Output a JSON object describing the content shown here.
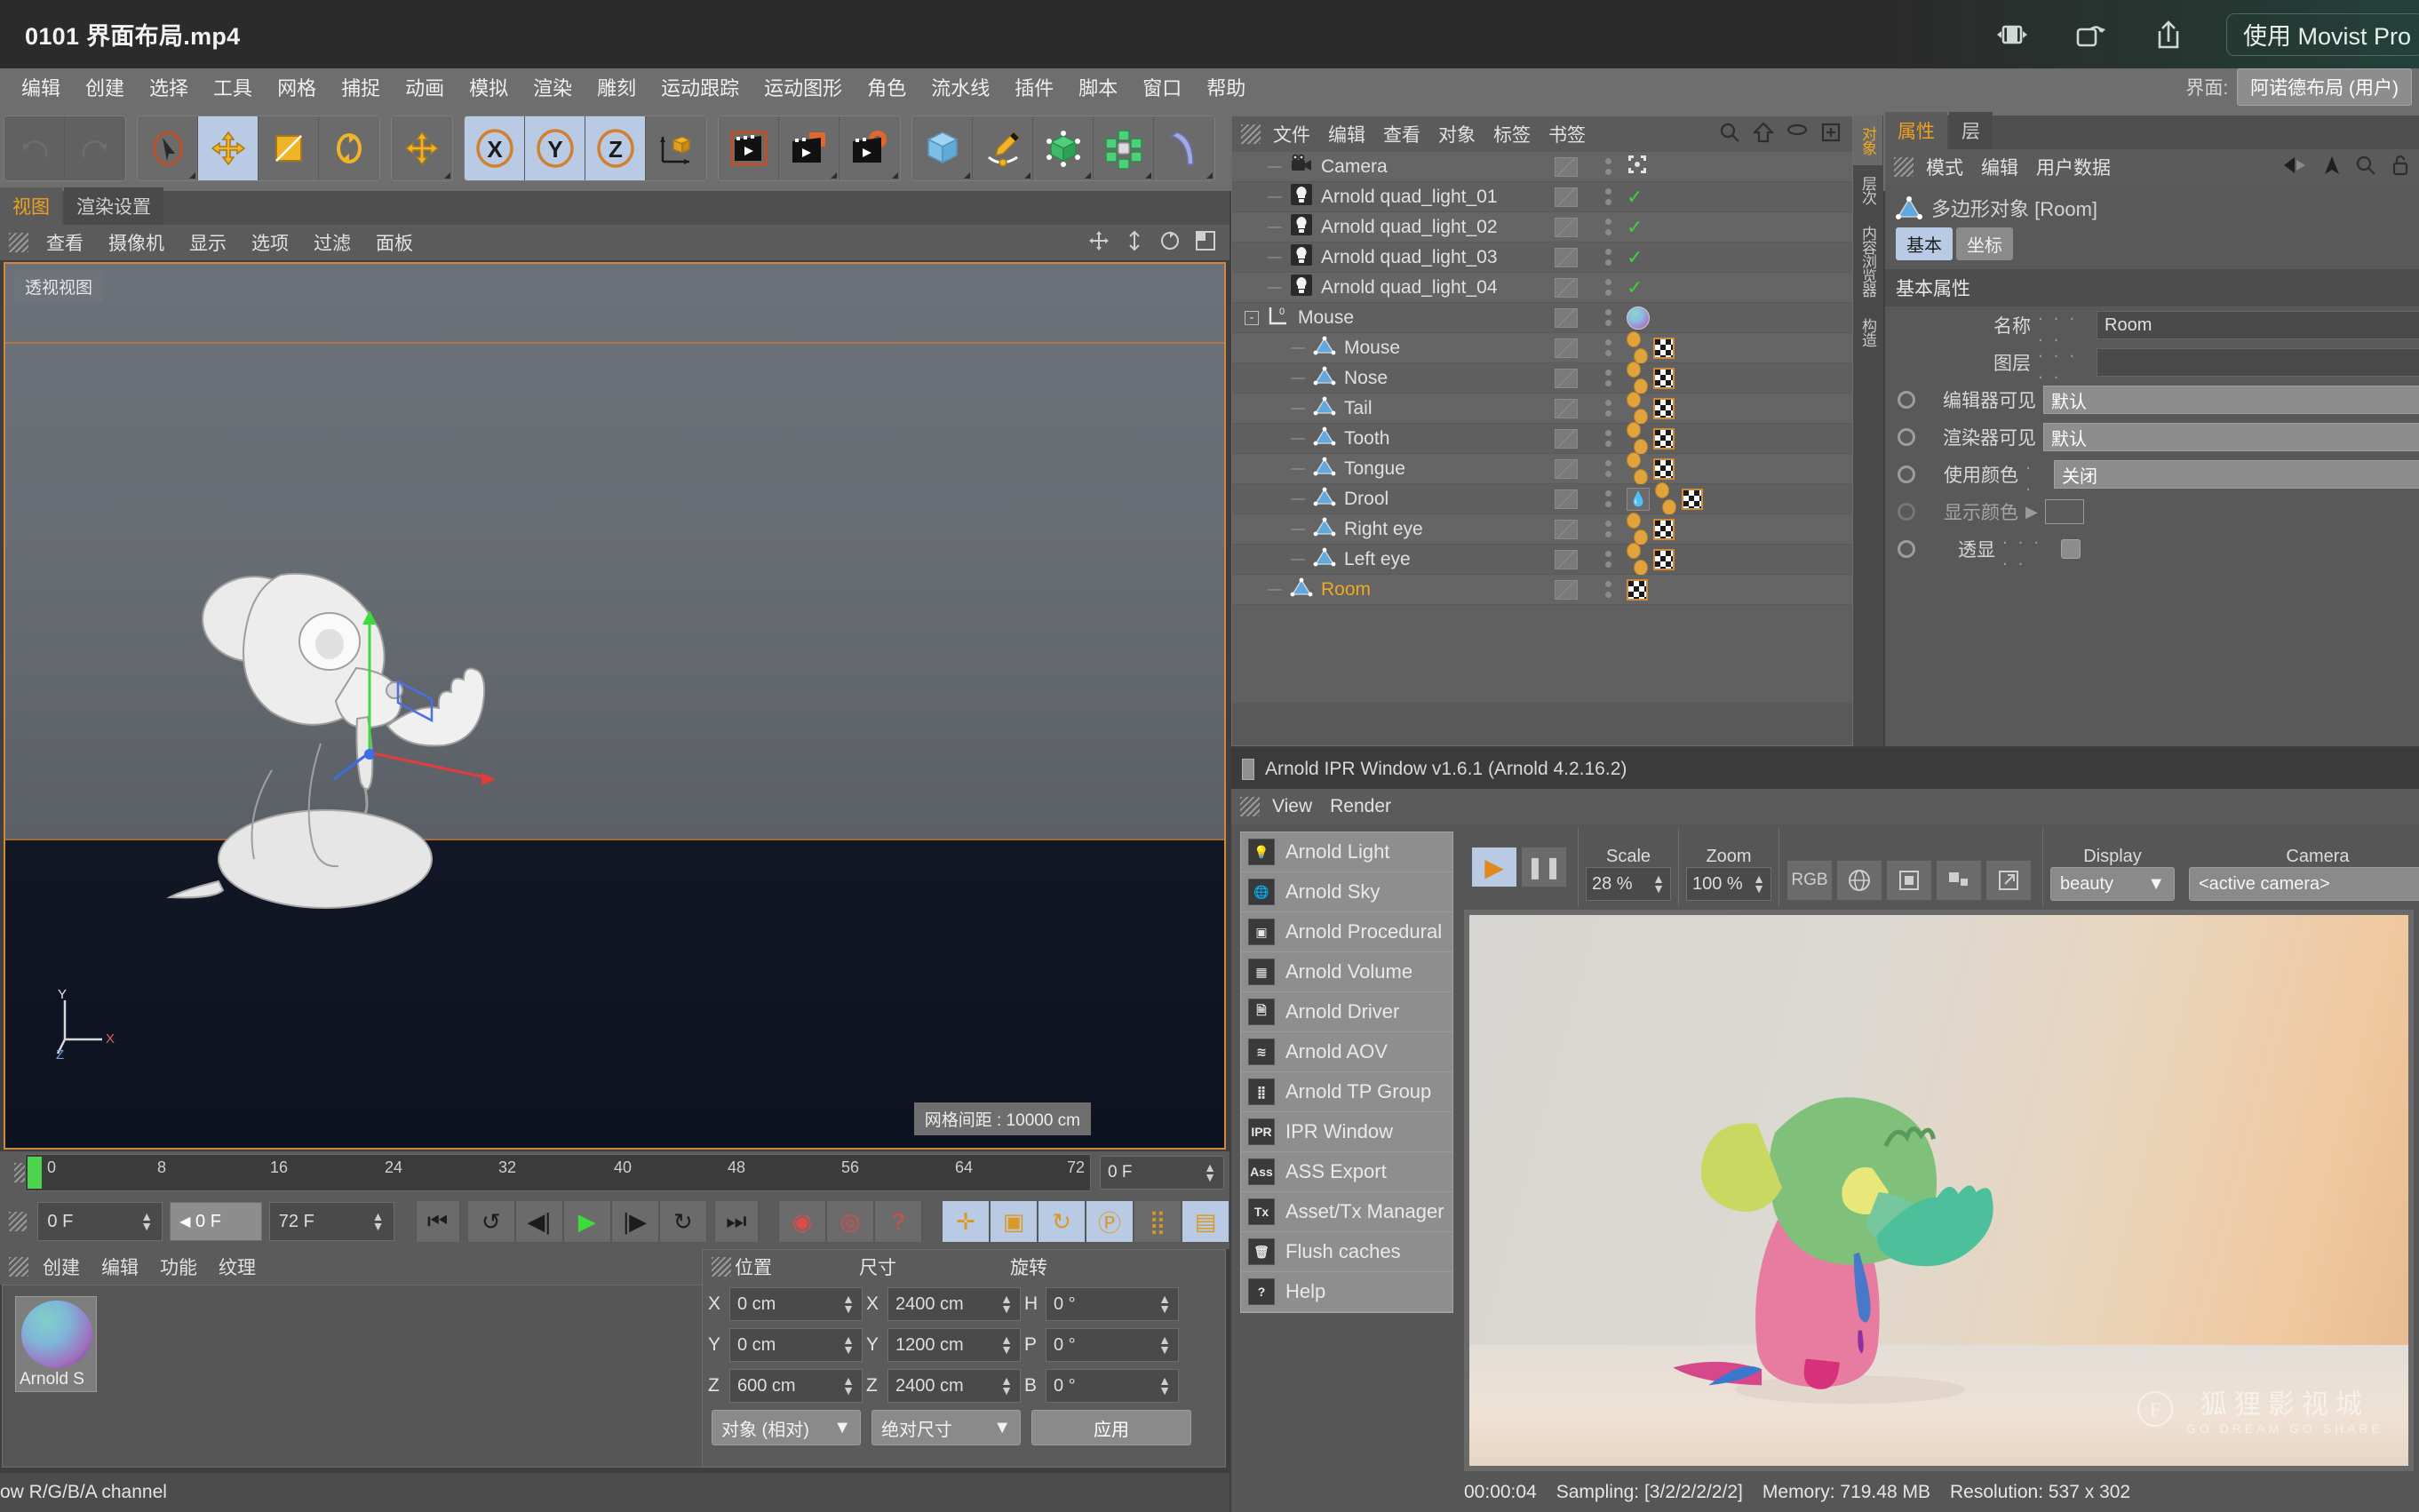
{
  "media": {
    "title": "0101 界面布局.mp4",
    "buttons": [
      "fullscreen-toggle-icon",
      "rotate-icon",
      "share-icon"
    ],
    "promo": "使用 Movist Pro"
  },
  "menubar": {
    "items": [
      "编辑",
      "创建",
      "选择",
      "工具",
      "网格",
      "捕捉",
      "动画",
      "模拟",
      "渲染",
      "雕刻",
      "运动跟踪",
      "运动图形",
      "角色",
      "流水线",
      "插件",
      "脚本",
      "窗口",
      "帮助"
    ],
    "layout_label": "界面:",
    "layout_value": "阿诺德布局 (用户)"
  },
  "toolbar": {
    "groups": [
      {
        "name": "undo-redo",
        "buttons": [
          {
            "icon": "undo-icon"
          },
          {
            "icon": "redo-icon"
          }
        ]
      },
      {
        "name": "transform",
        "buttons": [
          {
            "icon": "select-arrow-icon",
            "active": false
          },
          {
            "icon": "move-icon",
            "active": true
          },
          {
            "icon": "scale-icon",
            "active": false
          },
          {
            "icon": "rotate-icon",
            "active": false
          }
        ]
      },
      {
        "name": "move-group",
        "buttons": [
          {
            "icon": "move-alt-icon",
            "active": false
          }
        ]
      },
      {
        "name": "axis-lock",
        "buttons": [
          {
            "icon": "axis-x-icon",
            "active": true,
            "label": "X"
          },
          {
            "icon": "axis-y-icon",
            "active": true,
            "label": "Y"
          },
          {
            "icon": "axis-z-icon",
            "active": true,
            "label": "Z"
          },
          {
            "icon": "world-coord-icon",
            "active": false
          }
        ]
      },
      {
        "name": "render",
        "buttons": [
          {
            "icon": "render-view-icon",
            "active": false
          },
          {
            "icon": "render-picture-viewer-icon",
            "active": false
          },
          {
            "icon": "render-settings-icon",
            "active": false
          }
        ]
      },
      {
        "name": "primitives",
        "buttons": [
          {
            "icon": "cube-icon"
          },
          {
            "icon": "spline-pen-icon"
          },
          {
            "icon": "nurbs-icon"
          },
          {
            "icon": "array-icon"
          },
          {
            "icon": "deformer-icon"
          }
        ]
      }
    ]
  },
  "viewport": {
    "tabs": [
      {
        "label": "视图",
        "active": true
      },
      {
        "label": "渲染设置",
        "active": false
      }
    ],
    "menu": [
      "查看",
      "摄像机",
      "显示",
      "选项",
      "过滤",
      "面板"
    ],
    "view_label": "透视视图",
    "grid_note": "网格间距 : 10000 cm",
    "axis": {
      "x": "X",
      "y": "Y",
      "z": "Z"
    }
  },
  "timeline": {
    "ticks": [
      "0",
      "8",
      "16",
      "24",
      "32",
      "40",
      "48",
      "56",
      "64",
      "72"
    ],
    "current_frame_right": "0 F",
    "current_frame": "0 F",
    "frame_prev": "0 F",
    "frame_end": "72 F",
    "transport": [
      "go-to-start-icon",
      "play-backwards-loop-icon",
      "step-back-icon",
      "play-icon",
      "step-forward-icon",
      "loop-icon"
    ],
    "goto_end": "go-to-end-icon",
    "keys": [
      "record-key-icon",
      "autokey-icon",
      "key-selection-icon"
    ],
    "key_toggles": [
      "key-position-icon",
      "key-scale-icon",
      "key-rotation-icon",
      "key-param-icon",
      "key-pla-icon",
      "key-more-icon"
    ]
  },
  "material_manager": {
    "menu": [
      "创建",
      "编辑",
      "功能",
      "纹理"
    ],
    "materials": [
      {
        "name": "Arnold S",
        "icon": "material-sphere-icon"
      }
    ]
  },
  "coordinates": {
    "headers": [
      "位置",
      "尺寸",
      "旋转"
    ],
    "rows": [
      {
        "pos_axis": "X",
        "pos": "0 cm",
        "size_axis": "X",
        "size": "2400 cm",
        "rot_axis": "H",
        "rot": "0 °"
      },
      {
        "pos_axis": "Y",
        "pos": "0 cm",
        "size_axis": "Y",
        "size": "1200 cm",
        "rot_axis": "P",
        "rot": "0 °"
      },
      {
        "pos_axis": "Z",
        "pos": "600 cm",
        "size_axis": "Z",
        "size": "2400 cm",
        "rot_axis": "B",
        "rot": "0 °"
      }
    ],
    "mode_left": "对象 (相对)",
    "mode_mid": "绝对尺寸",
    "apply": "应用"
  },
  "statusbar": {
    "text": "ow R/G/B/A channel"
  },
  "object_manager": {
    "menu": [
      "文件",
      "编辑",
      "查看",
      "对象",
      "标签",
      "书签"
    ],
    "icons": [
      "search-icon",
      "home-icon",
      "ellipse-icon",
      "add-layer-icon"
    ],
    "vtabs": [
      {
        "label": "对象",
        "active": true
      },
      {
        "label": "层次",
        "active": false
      },
      {
        "label": "内容浏览器",
        "active": false
      },
      {
        "label": "构造",
        "active": false
      }
    ],
    "rows": [
      {
        "name": "Camera",
        "icon": "camera-icon",
        "depth": 1,
        "tags": [
          "render-tag-icon"
        ],
        "selected": false
      },
      {
        "name": "Arnold quad_light_01",
        "icon": "light-icon",
        "depth": 1,
        "tags": [
          "check-icon"
        ],
        "selected": false
      },
      {
        "name": "Arnold quad_light_02",
        "icon": "light-icon",
        "depth": 1,
        "tags": [
          "check-icon"
        ],
        "selected": false
      },
      {
        "name": "Arnold quad_light_03",
        "icon": "light-icon",
        "depth": 1,
        "tags": [
          "check-icon"
        ],
        "selected": false
      },
      {
        "name": "Arnold quad_light_04",
        "icon": "light-icon",
        "depth": 1,
        "tags": [
          "check-icon"
        ],
        "selected": false
      },
      {
        "name": "Mouse",
        "icon": "null-object-icon",
        "depth": 0,
        "tags": [
          "material-tag-icon"
        ],
        "selected": false,
        "expanded": true
      },
      {
        "name": "Mouse",
        "icon": "polygon-icon",
        "depth": 2,
        "tags": [
          "ball-tag-icon",
          "checker-tag-icon"
        ],
        "selected": false
      },
      {
        "name": "Nose",
        "icon": "polygon-icon",
        "depth": 2,
        "tags": [
          "ball-tag-icon",
          "checker-tag-icon"
        ],
        "selected": false
      },
      {
        "name": "Tail",
        "icon": "polygon-icon",
        "depth": 2,
        "tags": [
          "ball-tag-icon",
          "checker-tag-icon"
        ],
        "selected": false
      },
      {
        "name": "Tooth",
        "icon": "polygon-icon",
        "depth": 2,
        "tags": [
          "ball-tag-icon",
          "checker-tag-icon"
        ],
        "selected": false
      },
      {
        "name": "Tongue",
        "icon": "polygon-icon",
        "depth": 2,
        "tags": [
          "ball-tag-icon",
          "checker-tag-icon"
        ],
        "selected": false
      },
      {
        "name": "Drool",
        "icon": "polygon-icon",
        "depth": 2,
        "tags": [
          "drop-tag-icon",
          "ball-tag-icon",
          "checker-tag-icon"
        ],
        "selected": false
      },
      {
        "name": "Right eye",
        "icon": "polygon-icon",
        "depth": 2,
        "tags": [
          "ball-tag-icon",
          "checker-tag-icon"
        ],
        "selected": false
      },
      {
        "name": "Left eye",
        "icon": "polygon-icon",
        "depth": 2,
        "tags": [
          "ball-tag-icon",
          "checker-tag-icon"
        ],
        "selected": false
      },
      {
        "name": "Room",
        "icon": "polygon-icon",
        "depth": 1,
        "tags": [
          "checker-tag-icon"
        ],
        "selected": true
      }
    ]
  },
  "attributes": {
    "tabs": [
      {
        "label": "属性",
        "active": true
      },
      {
        "label": "层",
        "active": false
      }
    ],
    "menu": [
      "模式",
      "编辑",
      "用户数据"
    ],
    "menu_icons": [
      "back-arrow-icon",
      "forward-arrow-icon",
      "search-icon",
      "lock-icon"
    ],
    "object_title": "多边形对象 [Room]",
    "subtabs": [
      {
        "label": "基本",
        "active": true
      },
      {
        "label": "坐标",
        "active": false
      }
    ],
    "section": "基本属性",
    "fields": [
      {
        "label": "名称",
        "dots": ". . . . .",
        "value": "Room",
        "type": "text"
      },
      {
        "label": "图层",
        "dots": ". . . . .",
        "value": "",
        "type": "text"
      },
      {
        "label": "编辑器可见",
        "dots": "",
        "value": "默认",
        "type": "dropdown",
        "radio": true
      },
      {
        "label": "渲染器可见",
        "dots": "",
        "value": "默认",
        "type": "dropdown",
        "radio": true
      },
      {
        "label": "使用颜色",
        "dots": ". .",
        "value": "关闭",
        "type": "dropdown",
        "radio": true
      },
      {
        "label": "显示颜色",
        "dots": "",
        "value": "",
        "type": "color",
        "radio": true
      },
      {
        "label": "透显",
        "dots": ". . . . .",
        "value": "",
        "type": "checkbox",
        "radio": true
      }
    ]
  },
  "ipr": {
    "title": "Arnold IPR Window v1.6.1 (Arnold 4.2.16.2)",
    "menu": [
      "View",
      "Render"
    ],
    "plugin_menu": [
      {
        "label": "Arnold Light",
        "icon": "light-bulb-icon"
      },
      {
        "label": "Arnold Sky",
        "icon": "globe-icon"
      },
      {
        "label": "Arnold Procedural",
        "icon": "procedural-cube-icon"
      },
      {
        "label": "Arnold Volume",
        "icon": "volume-cube-icon"
      },
      {
        "label": "Arnold Driver",
        "icon": "driver-file-icon"
      },
      {
        "label": "Arnold AOV",
        "icon": "aov-layers-icon"
      },
      {
        "label": "Arnold TP Group",
        "icon": "tp-group-icon"
      },
      {
        "label": "IPR Window",
        "icon": "ipr-icon"
      },
      {
        "label": "ASS Export",
        "icon": "ass-icon"
      },
      {
        "label": "Asset/Tx Manager",
        "icon": "tx-icon"
      },
      {
        "label": "Flush caches",
        "icon": "trash-icon"
      },
      {
        "label": "Help",
        "icon": "question-icon"
      }
    ],
    "play_icon": "play-icon",
    "pause_icon": "pause-icon",
    "scale_label": "Scale",
    "scale_value": "28 %",
    "zoom_label": "Zoom",
    "zoom_value": "100 %",
    "channel_buttons": [
      {
        "label": "RGB",
        "name": "rgb-button"
      },
      {
        "label": "",
        "name": "globe-button"
      },
      {
        "label": "",
        "name": "alpha-button"
      },
      {
        "label": "",
        "name": "region-button"
      },
      {
        "label": "",
        "name": "popout-button"
      }
    ],
    "display_label": "Display",
    "display_value": "beauty",
    "camera_label": "Camera",
    "camera_value": "<active camera>",
    "status": {
      "time": "00:00:04",
      "sampling": "Sampling: [3/2/2/2/2/2]",
      "memory": "Memory: 719.48 MB",
      "resolution": "Resolution: 537 x 302"
    },
    "watermark_line1": "狐狸影视城",
    "watermark_line2": "GO DREAM GO SHARE"
  }
}
